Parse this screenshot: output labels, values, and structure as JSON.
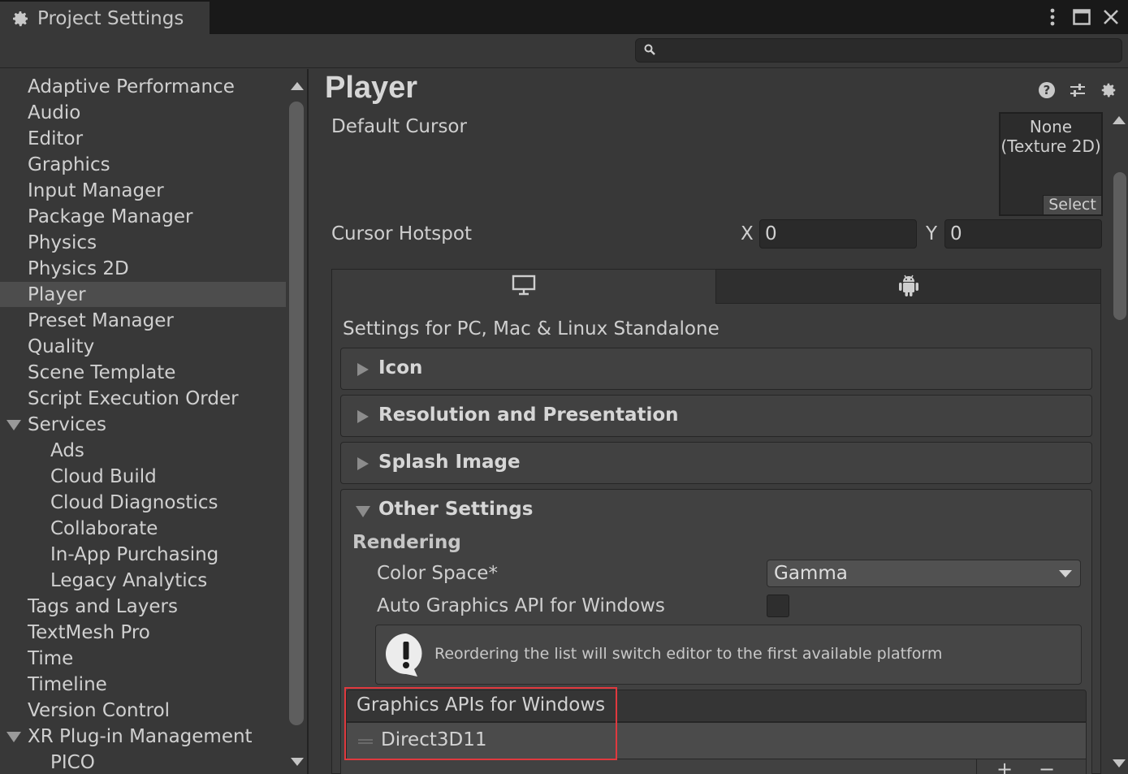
{
  "window": {
    "tab_title": "Project Settings",
    "tab_icon": "gear-icon",
    "controls": [
      "more-icon",
      "maximize-icon",
      "close-icon"
    ]
  },
  "search": {
    "icon": "search-icon",
    "value": ""
  },
  "sidebar": {
    "items": [
      {
        "label": "Adaptive Performance",
        "selected": false
      },
      {
        "label": "Audio",
        "selected": false
      },
      {
        "label": "Editor",
        "selected": false
      },
      {
        "label": "Graphics",
        "selected": false
      },
      {
        "label": "Input Manager",
        "selected": false
      },
      {
        "label": "Package Manager",
        "selected": false
      },
      {
        "label": "Physics",
        "selected": false
      },
      {
        "label": "Physics 2D",
        "selected": false
      },
      {
        "label": "Player",
        "selected": true
      },
      {
        "label": "Preset Manager",
        "selected": false
      },
      {
        "label": "Quality",
        "selected": false
      },
      {
        "label": "Scene Template",
        "selected": false
      },
      {
        "label": "Script Execution Order",
        "selected": false
      },
      {
        "label": "Services",
        "selected": false,
        "expanded": true
      },
      {
        "label": "Ads",
        "selected": false,
        "child": true
      },
      {
        "label": "Cloud Build",
        "selected": false,
        "child": true
      },
      {
        "label": "Cloud Diagnostics",
        "selected": false,
        "child": true
      },
      {
        "label": "Collaborate",
        "selected": false,
        "child": true
      },
      {
        "label": "In-App Purchasing",
        "selected": false,
        "child": true
      },
      {
        "label": "Legacy Analytics",
        "selected": false,
        "child": true
      },
      {
        "label": "Tags and Layers",
        "selected": false
      },
      {
        "label": "TextMesh Pro",
        "selected": false
      },
      {
        "label": "Time",
        "selected": false
      },
      {
        "label": "Timeline",
        "selected": false
      },
      {
        "label": "Version Control",
        "selected": false
      },
      {
        "label": "XR Plug-in Management",
        "selected": false,
        "expanded": true
      },
      {
        "label": "PICO",
        "selected": false,
        "child": true
      }
    ]
  },
  "main": {
    "title": "Player",
    "header_icons": [
      "help-icon",
      "presets-icon",
      "settings-gear-icon"
    ],
    "default_cursor": {
      "label": "Default Cursor",
      "texture_line1": "None",
      "texture_line2": "(Texture 2D)",
      "select_label": "Select"
    },
    "cursor_hotspot": {
      "label": "Cursor Hotspot",
      "x_label": "X",
      "x_value": "0",
      "y_label": "Y",
      "y_value": "0"
    },
    "platform_tabs": [
      {
        "icon": "monitor-icon",
        "active": true
      },
      {
        "icon": "android-icon",
        "active": false
      }
    ],
    "platform_title": "Settings for PC, Mac & Linux Standalone",
    "foldouts": [
      {
        "label": "Icon",
        "expanded": false
      },
      {
        "label": "Resolution and Presentation",
        "expanded": false
      },
      {
        "label": "Splash Image",
        "expanded": false
      },
      {
        "label": "Other Settings",
        "expanded": true
      }
    ],
    "rendering": {
      "section_label": "Rendering",
      "color_space_label": "Color Space*",
      "color_space_value": "Gamma",
      "auto_api_label": "Auto Graphics API  for Windows",
      "auto_api_checked": false,
      "warning_text": "Reordering the list will switch editor to the first available platform",
      "apis_header": "Graphics APIs for Windows",
      "apis": [
        "Direct3D11"
      ]
    }
  },
  "colors": {
    "background": "#383838",
    "titlebar": "#191919",
    "selected_row": "#4d4d4d",
    "highlight_outline": "#e0393e"
  }
}
